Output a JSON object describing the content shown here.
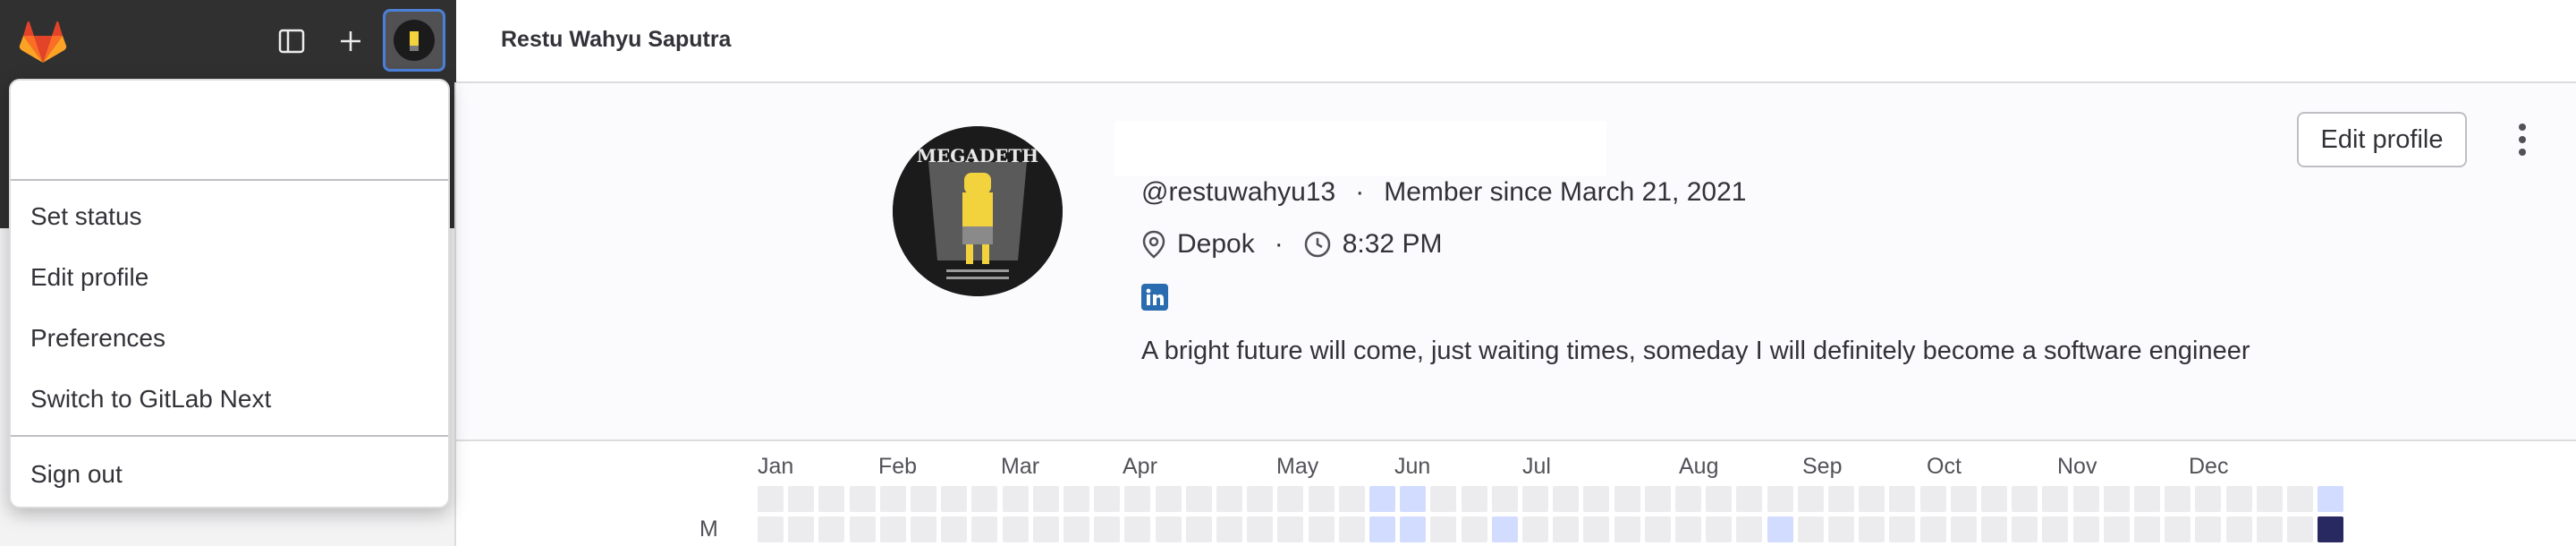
{
  "header": {
    "title": "Restu Wahyu Saputra"
  },
  "user_menu": {
    "items_group1": [
      "Set status",
      "Edit profile",
      "Preferences",
      "Switch to GitLab Next"
    ],
    "items_group2": [
      "Sign out"
    ]
  },
  "profile": {
    "username": "@restuwahyu13",
    "member_since": "Member since March 21, 2021",
    "location": "Depok",
    "local_time": "8:32 PM",
    "bio": "A bright future will come, just waiting times, someday I will definitely become a software engineer",
    "edit_profile_label": "Edit profile",
    "avatar_text": "MEGADETH"
  },
  "calendar": {
    "months": [
      "Jan",
      "Feb",
      "Mar",
      "Apr",
      "May",
      "Jun",
      "Jul",
      "Aug",
      "Sep",
      "Oct",
      "Nov",
      "Dec"
    ],
    "row_label": "M",
    "row1_levels": [
      0,
      0,
      0,
      0,
      0,
      0,
      0,
      0,
      0,
      0,
      0,
      0,
      0,
      0,
      0,
      0,
      0,
      0,
      0,
      0,
      1,
      1,
      0,
      0,
      0,
      0,
      0,
      0,
      0,
      0,
      0,
      0,
      0,
      0,
      0,
      0,
      0,
      0,
      0,
      0,
      0,
      0,
      0,
      0,
      0,
      0,
      0,
      0,
      0,
      0,
      0,
      1
    ],
    "row2_levels": [
      0,
      0,
      0,
      0,
      0,
      0,
      0,
      0,
      0,
      0,
      0,
      0,
      0,
      0,
      0,
      0,
      0,
      0,
      0,
      0,
      1,
      1,
      0,
      0,
      1,
      0,
      0,
      0,
      0,
      0,
      0,
      0,
      0,
      1,
      0,
      0,
      0,
      0,
      0,
      0,
      0,
      0,
      0,
      0,
      0,
      0,
      0,
      0,
      0,
      0,
      0,
      2
    ]
  },
  "colors": {
    "accent": "#4b80d8",
    "contrib_low": "#d2dcff",
    "contrib_high": "#292961",
    "linkedin": "#2a6cb0"
  }
}
